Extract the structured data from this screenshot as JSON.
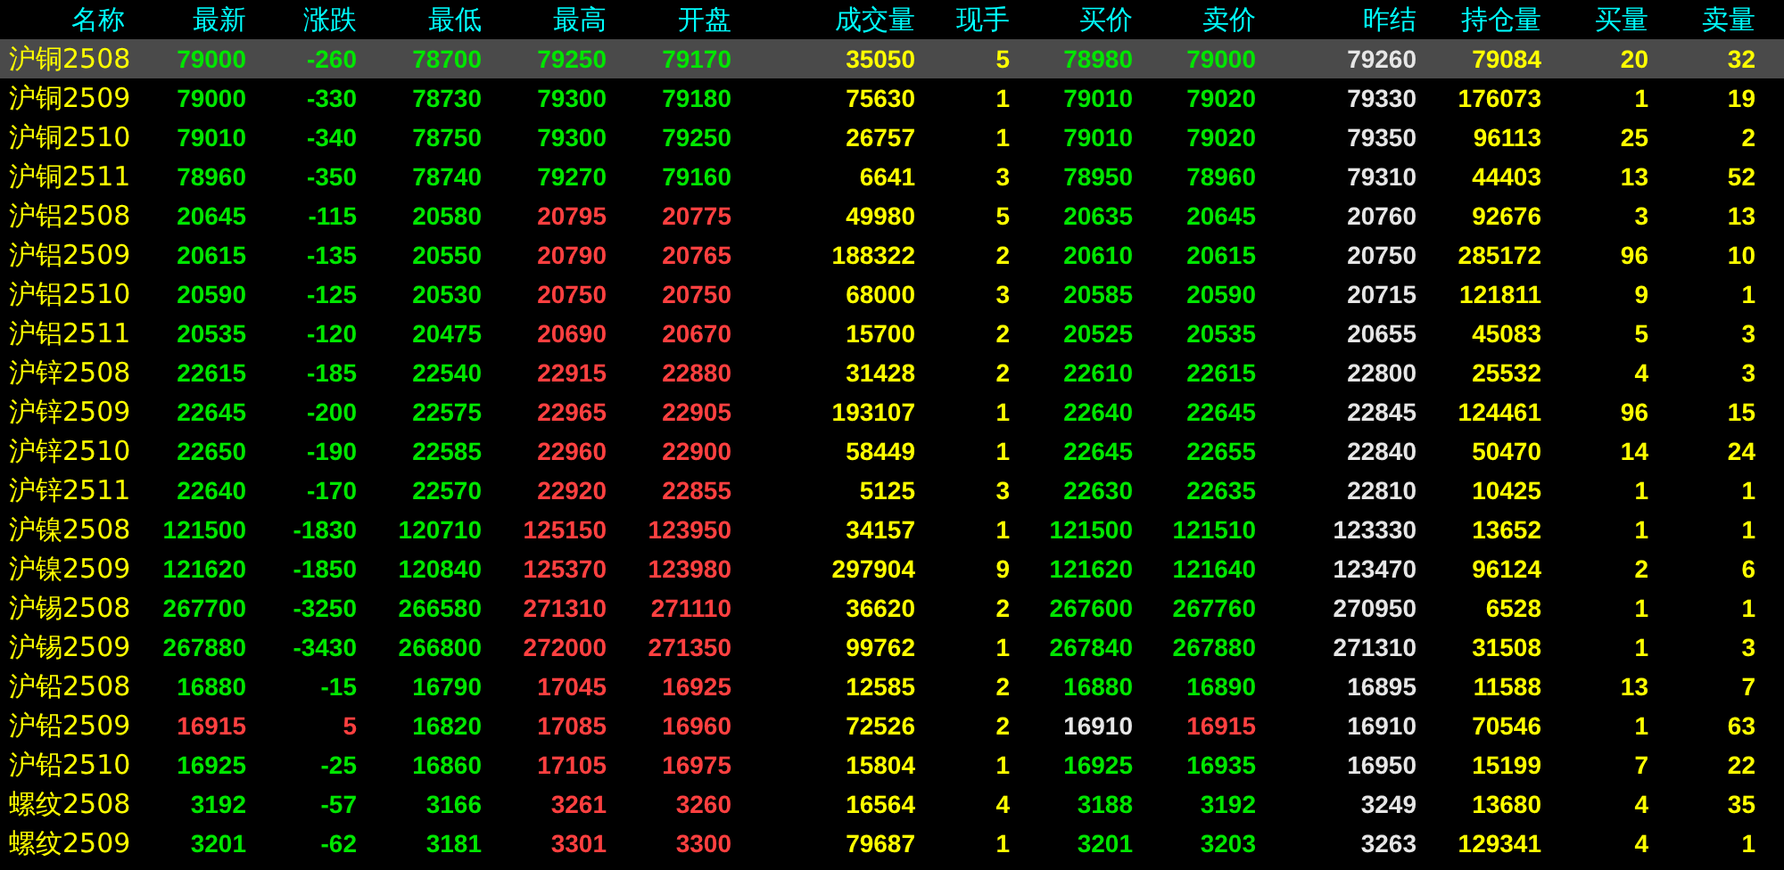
{
  "columns": [
    {
      "label": "名称",
      "kind": "name"
    },
    {
      "label": "最新",
      "kind": "price"
    },
    {
      "label": "涨跌",
      "kind": "price"
    },
    {
      "label": "最低",
      "kind": "price"
    },
    {
      "label": "最高",
      "kind": "price"
    },
    {
      "label": "开盘",
      "kind": "price"
    },
    {
      "label": "成交量",
      "kind": "volume"
    },
    {
      "label": "现手",
      "kind": "volume"
    },
    {
      "label": "买价",
      "kind": "price"
    },
    {
      "label": "卖价",
      "kind": "price"
    },
    {
      "label": "昨结",
      "kind": "settle"
    },
    {
      "label": "持仓量",
      "kind": "volume"
    },
    {
      "label": "买量",
      "kind": "volume"
    },
    {
      "label": "卖量",
      "kind": "volume"
    }
  ],
  "rows": [
    {
      "selected": true,
      "cells": [
        "沪铜2508",
        {
          "text": "79000",
          "color": "#00e600"
        },
        {
          "text": "-260",
          "color": "#00e600"
        },
        {
          "text": "78700",
          "color": "#00e600"
        },
        {
          "text": "79250",
          "color": "#00e600"
        },
        {
          "text": "79170",
          "color": "#00e600"
        },
        "35050",
        "5",
        {
          "text": "78980",
          "color": "#00e600"
        },
        {
          "text": "79000",
          "color": "#00e600"
        },
        "79260",
        "79084",
        "20",
        "32"
      ]
    },
    {
      "selected": false,
      "cells": [
        "沪铜2509",
        {
          "text": "79000",
          "color": "#00e600"
        },
        {
          "text": "-330",
          "color": "#00e600"
        },
        {
          "text": "78730",
          "color": "#00e600"
        },
        {
          "text": "79300",
          "color": "#00e600"
        },
        {
          "text": "79180",
          "color": "#00e600"
        },
        "75630",
        "1",
        {
          "text": "79010",
          "color": "#00e600"
        },
        {
          "text": "79020",
          "color": "#00e600"
        },
        "79330",
        "176073",
        "1",
        "19"
      ]
    },
    {
      "selected": false,
      "cells": [
        "沪铜2510",
        {
          "text": "79010",
          "color": "#00e600"
        },
        {
          "text": "-340",
          "color": "#00e600"
        },
        {
          "text": "78750",
          "color": "#00e600"
        },
        {
          "text": "79300",
          "color": "#00e600"
        },
        {
          "text": "79250",
          "color": "#00e600"
        },
        "26757",
        "1",
        {
          "text": "79010",
          "color": "#00e600"
        },
        {
          "text": "79020",
          "color": "#00e600"
        },
        "79350",
        "96113",
        "25",
        "2"
      ]
    },
    {
      "selected": false,
      "cells": [
        "沪铜2511",
        {
          "text": "78960",
          "color": "#00e600"
        },
        {
          "text": "-350",
          "color": "#00e600"
        },
        {
          "text": "78740",
          "color": "#00e600"
        },
        {
          "text": "79270",
          "color": "#00e600"
        },
        {
          "text": "79160",
          "color": "#00e600"
        },
        "6641",
        "3",
        {
          "text": "78950",
          "color": "#00e600"
        },
        {
          "text": "78960",
          "color": "#00e600"
        },
        "79310",
        "44403",
        "13",
        "52"
      ]
    },
    {
      "selected": false,
      "cells": [
        "沪铝2508",
        {
          "text": "20645",
          "color": "#00e600"
        },
        {
          "text": "-115",
          "color": "#00e600"
        },
        {
          "text": "20580",
          "color": "#00e600"
        },
        {
          "text": "20795",
          "color": "#ff4040"
        },
        {
          "text": "20775",
          "color": "#ff4040"
        },
        "49980",
        "5",
        {
          "text": "20635",
          "color": "#00e600"
        },
        {
          "text": "20645",
          "color": "#00e600"
        },
        "20760",
        "92676",
        "3",
        "13"
      ]
    },
    {
      "selected": false,
      "cells": [
        "沪铝2509",
        {
          "text": "20615",
          "color": "#00e600"
        },
        {
          "text": "-135",
          "color": "#00e600"
        },
        {
          "text": "20550",
          "color": "#00e600"
        },
        {
          "text": "20790",
          "color": "#ff4040"
        },
        {
          "text": "20765",
          "color": "#ff4040"
        },
        "188322",
        "2",
        {
          "text": "20610",
          "color": "#00e600"
        },
        {
          "text": "20615",
          "color": "#00e600"
        },
        "20750",
        "285172",
        "96",
        "10"
      ]
    },
    {
      "selected": false,
      "cells": [
        "沪铝2510",
        {
          "text": "20590",
          "color": "#00e600"
        },
        {
          "text": "-125",
          "color": "#00e600"
        },
        {
          "text": "20530",
          "color": "#00e600"
        },
        {
          "text": "20750",
          "color": "#ff4040"
        },
        {
          "text": "20750",
          "color": "#ff4040"
        },
        "68000",
        "3",
        {
          "text": "20585",
          "color": "#00e600"
        },
        {
          "text": "20590",
          "color": "#00e600"
        },
        "20715",
        "121811",
        "9",
        "1"
      ]
    },
    {
      "selected": false,
      "cells": [
        "沪铝2511",
        {
          "text": "20535",
          "color": "#00e600"
        },
        {
          "text": "-120",
          "color": "#00e600"
        },
        {
          "text": "20475",
          "color": "#00e600"
        },
        {
          "text": "20690",
          "color": "#ff4040"
        },
        {
          "text": "20670",
          "color": "#ff4040"
        },
        "15700",
        "2",
        {
          "text": "20525",
          "color": "#00e600"
        },
        {
          "text": "20535",
          "color": "#00e600"
        },
        "20655",
        "45083",
        "5",
        "3"
      ]
    },
    {
      "selected": false,
      "cells": [
        "沪锌2508",
        {
          "text": "22615",
          "color": "#00e600"
        },
        {
          "text": "-185",
          "color": "#00e600"
        },
        {
          "text": "22540",
          "color": "#00e600"
        },
        {
          "text": "22915",
          "color": "#ff4040"
        },
        {
          "text": "22880",
          "color": "#ff4040"
        },
        "31428",
        "2",
        {
          "text": "22610",
          "color": "#00e600"
        },
        {
          "text": "22615",
          "color": "#00e600"
        },
        "22800",
        "25532",
        "4",
        "3"
      ]
    },
    {
      "selected": false,
      "cells": [
        "沪锌2509",
        {
          "text": "22645",
          "color": "#00e600"
        },
        {
          "text": "-200",
          "color": "#00e600"
        },
        {
          "text": "22575",
          "color": "#00e600"
        },
        {
          "text": "22965",
          "color": "#ff4040"
        },
        {
          "text": "22905",
          "color": "#ff4040"
        },
        "193107",
        "1",
        {
          "text": "22640",
          "color": "#00e600"
        },
        {
          "text": "22645",
          "color": "#00e600"
        },
        "22845",
        "124461",
        "96",
        "15"
      ]
    },
    {
      "selected": false,
      "cells": [
        "沪锌2510",
        {
          "text": "22650",
          "color": "#00e600"
        },
        {
          "text": "-190",
          "color": "#00e600"
        },
        {
          "text": "22585",
          "color": "#00e600"
        },
        {
          "text": "22960",
          "color": "#ff4040"
        },
        {
          "text": "22900",
          "color": "#ff4040"
        },
        "58449",
        "1",
        {
          "text": "22645",
          "color": "#00e600"
        },
        {
          "text": "22655",
          "color": "#00e600"
        },
        "22840",
        "50470",
        "14",
        "24"
      ]
    },
    {
      "selected": false,
      "cells": [
        "沪锌2511",
        {
          "text": "22640",
          "color": "#00e600"
        },
        {
          "text": "-170",
          "color": "#00e600"
        },
        {
          "text": "22570",
          "color": "#00e600"
        },
        {
          "text": "22920",
          "color": "#ff4040"
        },
        {
          "text": "22855",
          "color": "#ff4040"
        },
        "5125",
        "3",
        {
          "text": "22630",
          "color": "#00e600"
        },
        {
          "text": "22635",
          "color": "#00e600"
        },
        "22810",
        "10425",
        "1",
        "1"
      ]
    },
    {
      "selected": false,
      "cells": [
        "沪镍2508",
        {
          "text": "121500",
          "color": "#00e600"
        },
        {
          "text": "-1830",
          "color": "#00e600"
        },
        {
          "text": "120710",
          "color": "#00e600"
        },
        {
          "text": "125150",
          "color": "#ff4040"
        },
        {
          "text": "123950",
          "color": "#ff4040"
        },
        "34157",
        "1",
        {
          "text": "121500",
          "color": "#00e600"
        },
        {
          "text": "121510",
          "color": "#00e600"
        },
        "123330",
        "13652",
        "1",
        "1"
      ]
    },
    {
      "selected": false,
      "cells": [
        "沪镍2509",
        {
          "text": "121620",
          "color": "#00e600"
        },
        {
          "text": "-1850",
          "color": "#00e600"
        },
        {
          "text": "120840",
          "color": "#00e600"
        },
        {
          "text": "125370",
          "color": "#ff4040"
        },
        {
          "text": "123980",
          "color": "#ff4040"
        },
        "297904",
        "9",
        {
          "text": "121620",
          "color": "#00e600"
        },
        {
          "text": "121640",
          "color": "#00e600"
        },
        "123470",
        "96124",
        "2",
        "6"
      ]
    },
    {
      "selected": false,
      "cells": [
        "沪锡2508",
        {
          "text": "267700",
          "color": "#00e600"
        },
        {
          "text": "-3250",
          "color": "#00e600"
        },
        {
          "text": "266580",
          "color": "#00e600"
        },
        {
          "text": "271310",
          "color": "#ff4040"
        },
        {
          "text": "271110",
          "color": "#ff4040"
        },
        "36620",
        "2",
        {
          "text": "267600",
          "color": "#00e600"
        },
        {
          "text": "267760",
          "color": "#00e600"
        },
        "270950",
        "6528",
        "1",
        "1"
      ]
    },
    {
      "selected": false,
      "cells": [
        "沪锡2509",
        {
          "text": "267880",
          "color": "#00e600"
        },
        {
          "text": "-3430",
          "color": "#00e600"
        },
        {
          "text": "266800",
          "color": "#00e600"
        },
        {
          "text": "272000",
          "color": "#ff4040"
        },
        {
          "text": "271350",
          "color": "#ff4040"
        },
        "99762",
        "1",
        {
          "text": "267840",
          "color": "#00e600"
        },
        {
          "text": "267880",
          "color": "#00e600"
        },
        "271310",
        "31508",
        "1",
        "3"
      ]
    },
    {
      "selected": false,
      "cells": [
        "沪铅2508",
        {
          "text": "16880",
          "color": "#00e600"
        },
        {
          "text": "-15",
          "color": "#00e600"
        },
        {
          "text": "16790",
          "color": "#00e600"
        },
        {
          "text": "17045",
          "color": "#ff4040"
        },
        {
          "text": "16925",
          "color": "#ff4040"
        },
        "12585",
        "2",
        {
          "text": "16880",
          "color": "#00e600"
        },
        {
          "text": "16890",
          "color": "#00e600"
        },
        "16895",
        "11588",
        "13",
        "7"
      ]
    },
    {
      "selected": false,
      "cells": [
        "沪铅2509",
        {
          "text": "16915",
          "color": "#ff4040"
        },
        {
          "text": "5",
          "color": "#ff4040"
        },
        {
          "text": "16820",
          "color": "#00e600"
        },
        {
          "text": "17085",
          "color": "#ff4040"
        },
        {
          "text": "16960",
          "color": "#ff4040"
        },
        "72526",
        "2",
        {
          "text": "16910",
          "color": "#e6e6e6"
        },
        {
          "text": "16915",
          "color": "#ff4040"
        },
        "16910",
        "70546",
        "1",
        "63"
      ]
    },
    {
      "selected": false,
      "cells": [
        "沪铅2510",
        {
          "text": "16925",
          "color": "#00e600"
        },
        {
          "text": "-25",
          "color": "#00e600"
        },
        {
          "text": "16860",
          "color": "#00e600"
        },
        {
          "text": "17105",
          "color": "#ff4040"
        },
        {
          "text": "16975",
          "color": "#ff4040"
        },
        "15804",
        "1",
        {
          "text": "16925",
          "color": "#00e600"
        },
        {
          "text": "16935",
          "color": "#00e600"
        },
        "16950",
        "15199",
        "7",
        "22"
      ]
    },
    {
      "selected": false,
      "cells": [
        "螺纹2508",
        {
          "text": "3192",
          "color": "#00e600"
        },
        {
          "text": "-57",
          "color": "#00e600"
        },
        {
          "text": "3166",
          "color": "#00e600"
        },
        {
          "text": "3261",
          "color": "#ff4040"
        },
        {
          "text": "3260",
          "color": "#ff4040"
        },
        "16564",
        "4",
        {
          "text": "3188",
          "color": "#00e600"
        },
        {
          "text": "3192",
          "color": "#00e600"
        },
        "3249",
        "13680",
        "4",
        "35"
      ]
    },
    {
      "selected": false,
      "cells": [
        "螺纹2509",
        {
          "text": "3201",
          "color": "#00e600"
        },
        {
          "text": "-62",
          "color": "#00e600"
        },
        {
          "text": "3181",
          "color": "#00e600"
        },
        {
          "text": "3301",
          "color": "#ff4040"
        },
        {
          "text": "3300",
          "color": "#ff4040"
        },
        "79687",
        "1",
        {
          "text": "3201",
          "color": "#00e600"
        },
        {
          "text": "3203",
          "color": "#00e600"
        },
        "3263",
        "129341",
        "4",
        "1"
      ]
    }
  ]
}
